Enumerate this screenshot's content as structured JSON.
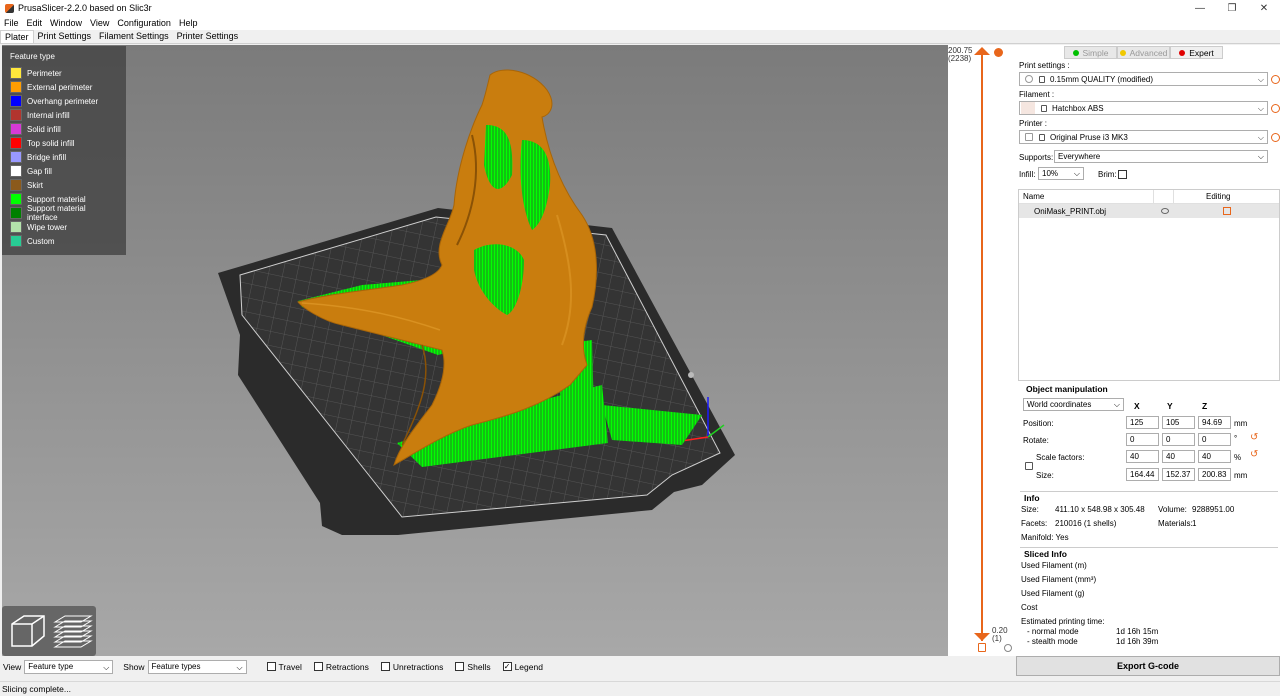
{
  "window": {
    "title": "PrusaSlicer-2.2.0 based on Slic3r",
    "minimize": "—",
    "maximize": "❐",
    "close": "✕"
  },
  "menu": [
    "File",
    "Edit",
    "Window",
    "View",
    "Configuration",
    "Help"
  ],
  "tabs": [
    "Plater",
    "Print Settings",
    "Filament Settings",
    "Printer Settings"
  ],
  "legend": {
    "title": "Feature type",
    "items": [
      {
        "label": "Perimeter",
        "color": "#ffe83c"
      },
      {
        "label": "External perimeter",
        "color": "#ff9d00"
      },
      {
        "label": "Overhang perimeter",
        "color": "#0000ff"
      },
      {
        "label": "Internal infill",
        "color": "#b2352e"
      },
      {
        "label": "Solid infill",
        "color": "#d63ad6"
      },
      {
        "label": "Top solid infill",
        "color": "#ff0000"
      },
      {
        "label": "Bridge infill",
        "color": "#9999ff"
      },
      {
        "label": "Gap fill",
        "color": "#ffffff"
      },
      {
        "label": "Skirt",
        "color": "#8b5a1c"
      },
      {
        "label": "Support material",
        "color": "#00ff00"
      },
      {
        "label": "Support material interface",
        "color": "#008000"
      },
      {
        "label": "Wipe tower",
        "color": "#b3e3ab"
      },
      {
        "label": "Custom",
        "color": "#28cc94"
      }
    ]
  },
  "slider": {
    "top_value": "200.75",
    "top_layer": "(2238)",
    "bottom_value": "0.20",
    "bottom_layer": "(1)"
  },
  "mode": {
    "simple": "Simple",
    "advanced": "Advanced",
    "expert": "Expert"
  },
  "presets": {
    "print_label": "Print settings :",
    "print_value": "0.15mm QUALITY (modified)",
    "filament_label": "Filament :",
    "filament_value": "Hatchbox ABS",
    "printer_label": "Printer :",
    "printer_value": "Original Pruse i3 MK3",
    "supports_label": "Supports:",
    "supports_value": "Everywhere",
    "infill_label": "Infill:",
    "infill_value": "10%",
    "brim_label": "Brim:"
  },
  "object_list": {
    "col_name": "Name",
    "col_editing": "Editing",
    "object_name": "OniMask_PRINT.obj"
  },
  "object_manipulation": {
    "title": "Object manipulation",
    "coords": "World coordinates",
    "x": "X",
    "y": "Y",
    "z": "Z",
    "position_label": "Position:",
    "position": [
      "125",
      "105",
      "94.69"
    ],
    "position_unit": "mm",
    "rotate_label": "Rotate:",
    "rotate": [
      "0",
      "0",
      "0"
    ],
    "rotate_unit": "°",
    "scale_label": "Scale factors:",
    "scale": [
      "40",
      "40",
      "40"
    ],
    "scale_unit": "%",
    "size_label": "Size:",
    "size": [
      "164.44",
      "152.37",
      "200.83"
    ],
    "size_unit": "mm"
  },
  "info": {
    "title": "Info",
    "size_label": "Size:",
    "size_value": "411.10 x 548.98 x 305.48",
    "volume_label": "Volume:",
    "volume_value": "9288951.00",
    "facets_label": "Facets:",
    "facets_value": "210016 (1 shells)",
    "materials_label": "Materials:",
    "materials_value": "1",
    "manifold": "Manifold: Yes"
  },
  "sliced_info": {
    "title": "Sliced Info",
    "used_m": "Used Filament (m)",
    "used_mm3": "Used Filament (mm³)",
    "used_g": "Used Filament (g)",
    "cost": "Cost",
    "est_label": "Estimated printing time:",
    "normal_label": "- normal mode",
    "normal_value": "1d 16h 15m",
    "stealth_label": "- stealth mode",
    "stealth_value": "1d 16h 39m"
  },
  "bottom": {
    "view_label": "View",
    "view_value": "Feature type",
    "show_label": "Show",
    "show_value": "Feature types",
    "travel": "Travel",
    "retractions": "Retractions",
    "unretractions": "Unretractions",
    "shells": "Shells",
    "legend": "Legend",
    "export": "Export G-code"
  },
  "status": "Slicing complete..."
}
